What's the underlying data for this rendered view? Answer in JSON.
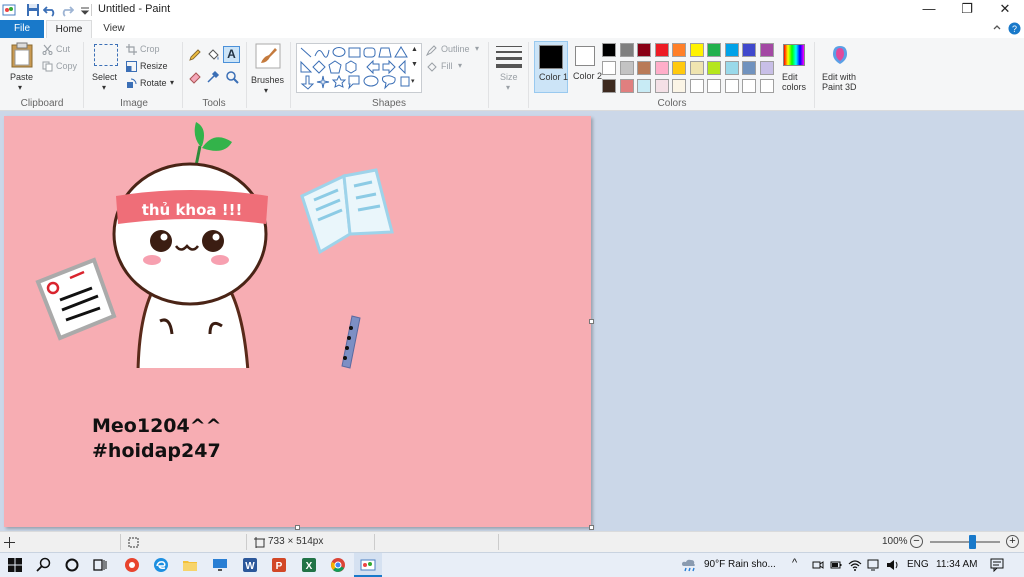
{
  "window": {
    "title": "Untitled - Paint",
    "minimize_glyph": "—",
    "maximize_glyph": "❐",
    "close_glyph": "✕"
  },
  "tabs": {
    "file": "File",
    "home": "Home",
    "view": "View"
  },
  "ribbon": {
    "clipboard": {
      "label": "Clipboard",
      "paste": "Paste",
      "cut": "Cut",
      "copy": "Copy"
    },
    "image": {
      "label": "Image",
      "select": "Select",
      "crop": "Crop",
      "resize": "Resize",
      "rotate": "Rotate"
    },
    "tools": {
      "label": "Tools"
    },
    "brushes": {
      "label": "Brushes"
    },
    "shapes": {
      "label": "Shapes",
      "outline": "Outline",
      "fill": "Fill"
    },
    "size": {
      "label": "Size"
    },
    "colors": {
      "label": "Colors",
      "color1": "Color 1",
      "color2": "Color 2",
      "edit_colors": "Edit colors",
      "edit_3d": "Edit with Paint 3D",
      "color1_value": "#000000",
      "color2_value": "#ffffff",
      "palette_row1": [
        "#000000",
        "#7f7f7f",
        "#880015",
        "#ed1c24",
        "#ff7f27",
        "#fff200",
        "#22b14c",
        "#00a2e8",
        "#3f48cc",
        "#a349a4"
      ],
      "palette_row2": [
        "#ffffff",
        "#c3c3c3",
        "#b97a57",
        "#ffaec9",
        "#ffc90e",
        "#efe4b0",
        "#b5e61d",
        "#99d9ea",
        "#7092be",
        "#c8bfe7"
      ],
      "palette_row3": [
        "#3d2a1f",
        "#e07f7f",
        "#c8ebf5",
        "#f4e0e6",
        "#fbf5e6",
        "#ffffff",
        "#ffffff",
        "#ffffff",
        "#ffffff",
        "#ffffff"
      ]
    }
  },
  "canvas": {
    "background": "#f7adb3",
    "headband_text": "thủ khoa !!!",
    "user_text": "Meo1204^^",
    "tag_text": "#hoidap247"
  },
  "status": {
    "dimensions": "733 × 514px",
    "zoom": "100%",
    "zoom_fraction": 0.6
  },
  "taskbar": {
    "weather": "90°F  Rain sho...",
    "lang": "ENG",
    "time": "11:34 AM"
  }
}
